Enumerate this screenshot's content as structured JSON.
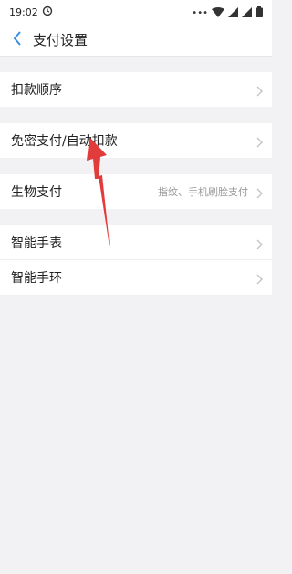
{
  "status_bar": {
    "time": "19:02"
  },
  "header": {
    "title": "支付设置"
  },
  "sections": [
    {
      "items": [
        {
          "label": "扣款顺序",
          "value": ""
        }
      ]
    },
    {
      "items": [
        {
          "label": "免密支付/自动扣款",
          "value": ""
        }
      ]
    },
    {
      "items": [
        {
          "label": "生物支付",
          "value": "指纹、手机刷脸支付"
        }
      ]
    },
    {
      "items": [
        {
          "label": "智能手表",
          "value": ""
        },
        {
          "label": "智能手环",
          "value": ""
        }
      ]
    }
  ],
  "colors": {
    "accent": "#3b8fdc",
    "annotation_arrow": "#e23b3b",
    "background": "#f2f2f4"
  },
  "icons": [
    "back-arrow-icon",
    "chevron-right-icon",
    "wifi-icon",
    "signal-icon",
    "battery-icon",
    "notification-icon"
  ]
}
